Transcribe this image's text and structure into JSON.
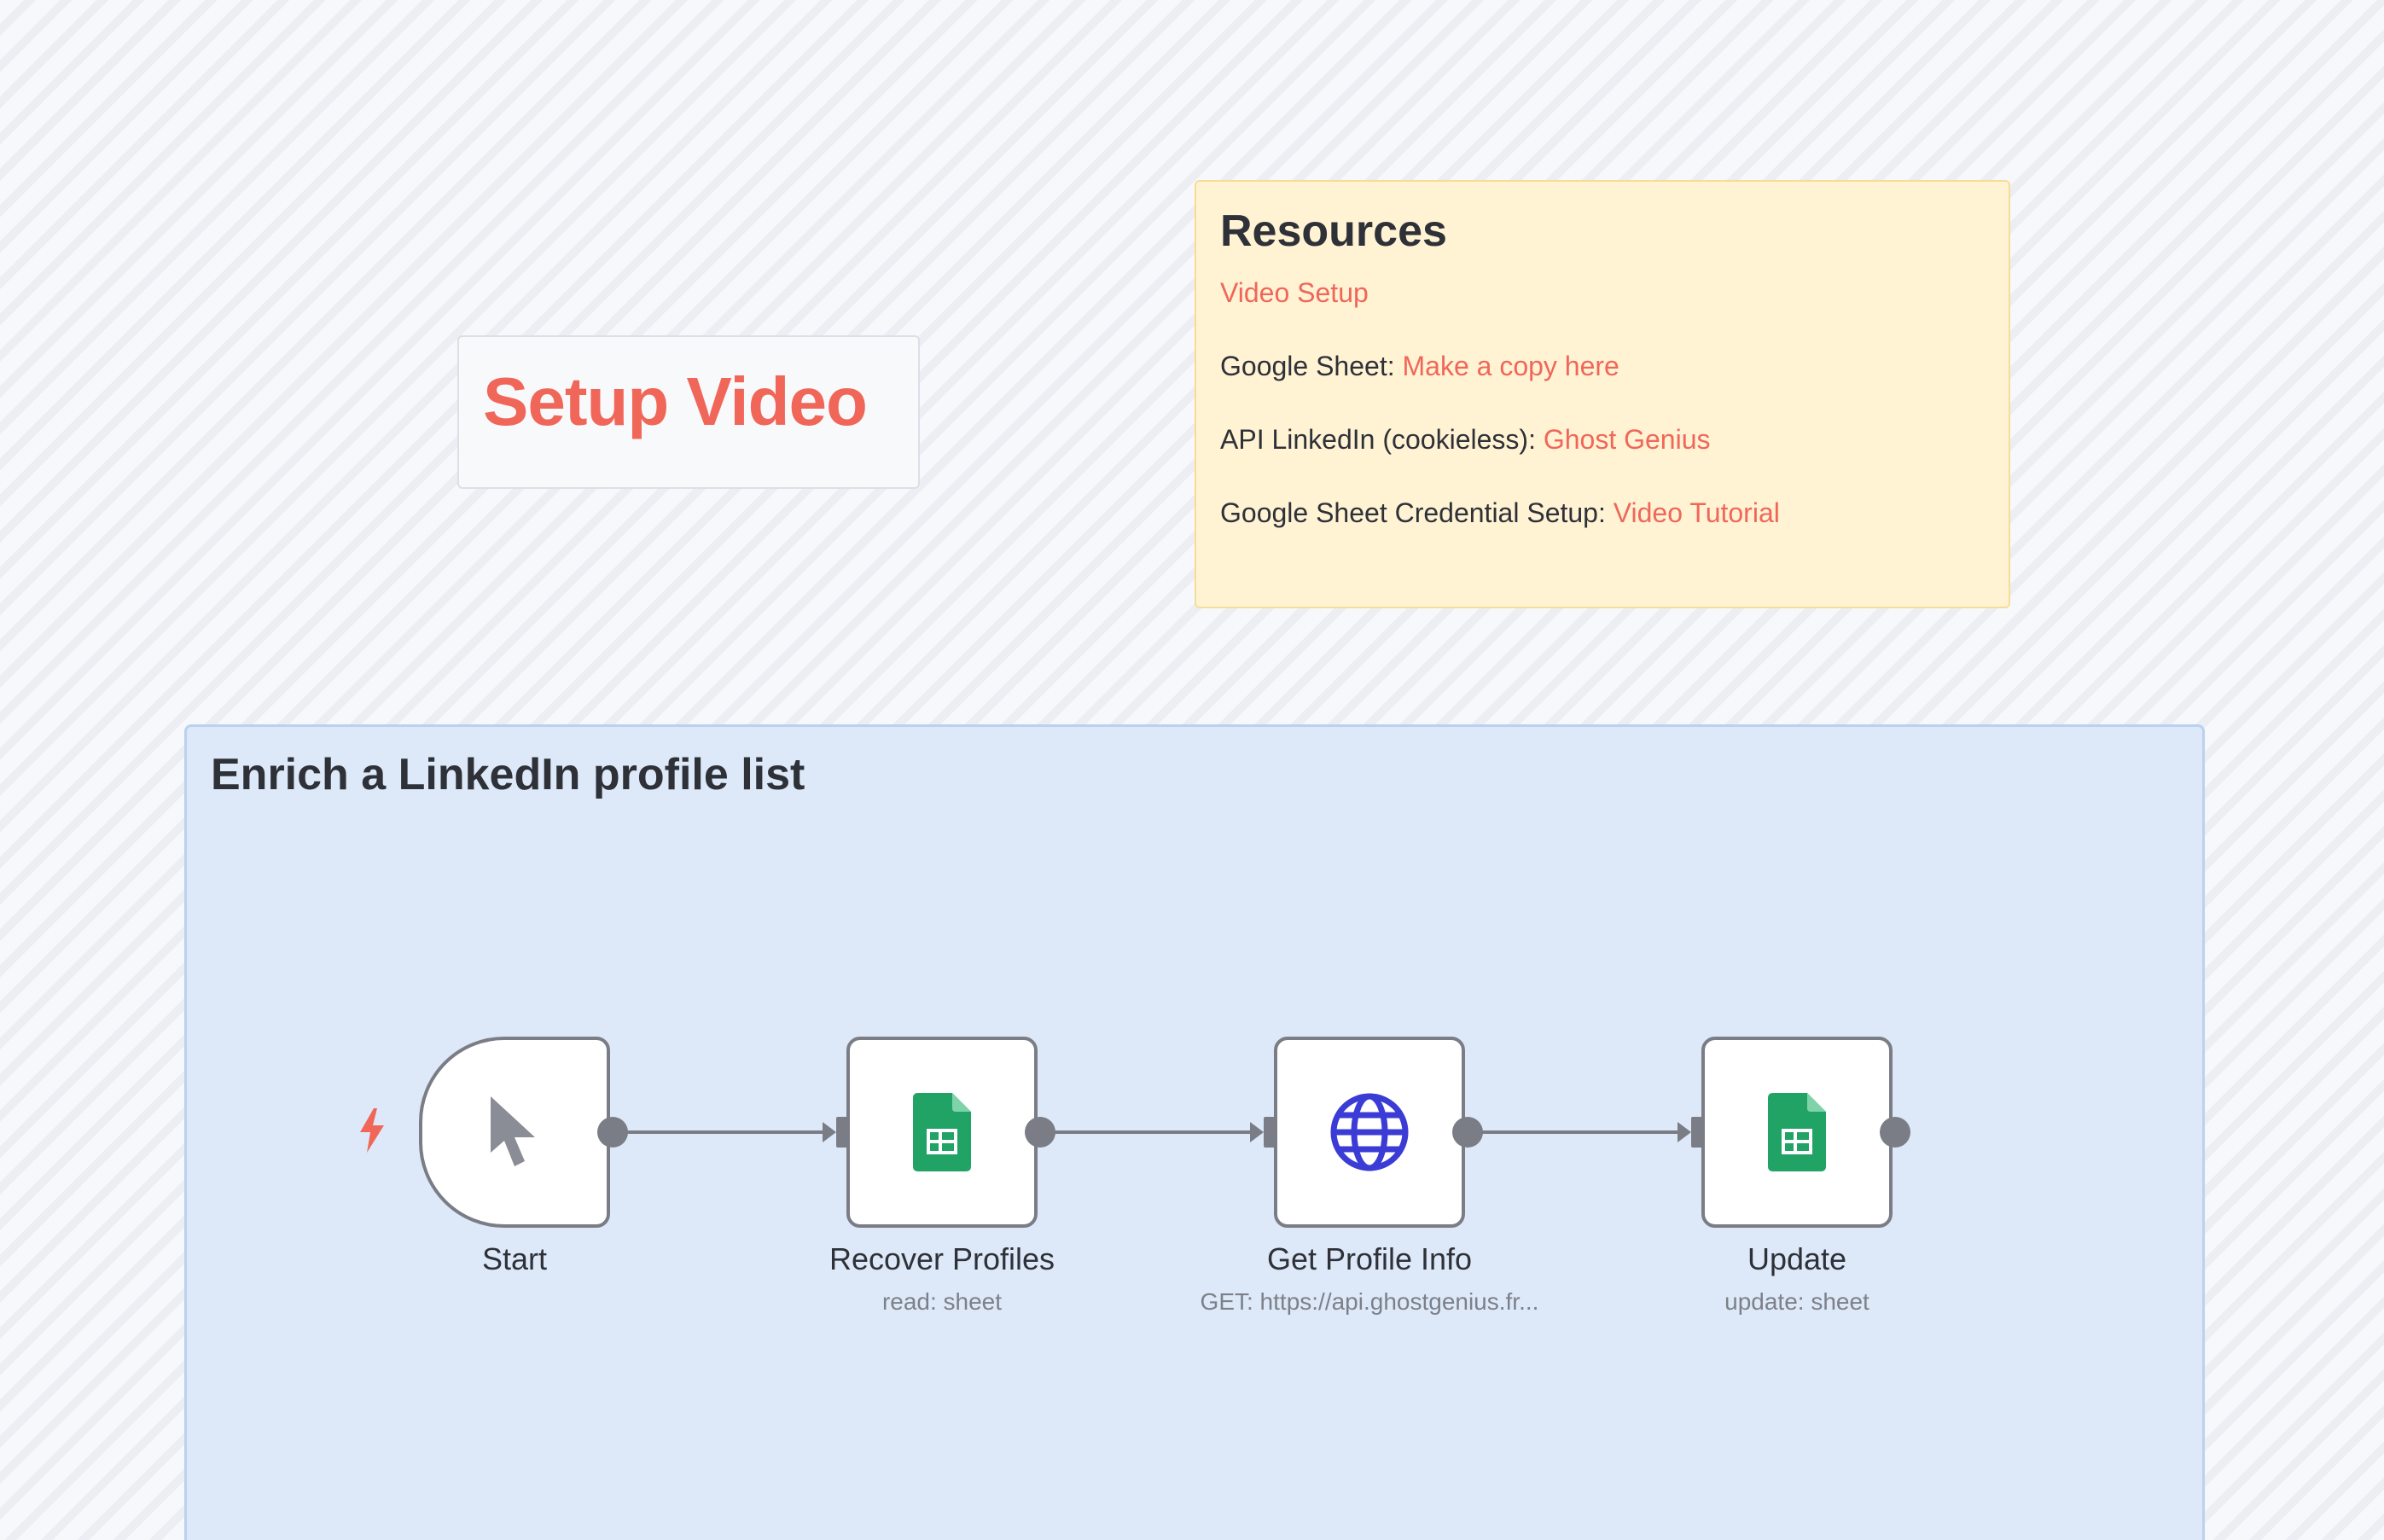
{
  "setup_sticky": {
    "title": "Setup Video"
  },
  "resources_sticky": {
    "title": "Resources",
    "video_setup_link": "Video Setup",
    "sheet_label": "Google Sheet: ",
    "sheet_link": "Make a copy here",
    "api_label": "API LinkedIn (cookieless): ",
    "api_link": "Ghost Genius",
    "credential_label": "Google Sheet Credential Setup: ",
    "credential_link": "Video Tutorial"
  },
  "group_sticky": {
    "title": "Enrich a LinkedIn profile list"
  },
  "nodes": [
    {
      "label": "Start",
      "subtitle": "",
      "icon": "cursor-icon"
    },
    {
      "label": "Recover Profiles",
      "subtitle": "read: sheet",
      "icon": "google-sheets-icon"
    },
    {
      "label": "Get Profile Info",
      "subtitle": "GET: https://api.ghostgenius.fr...",
      "icon": "globe-icon"
    },
    {
      "label": "Update",
      "subtitle": "update: sheet",
      "icon": "google-sheets-icon"
    }
  ],
  "colors": {
    "accent": "#f0675a",
    "node_border": "#7a7d85",
    "sheets_green": "#21a366",
    "globe_blue": "#3b3bd6",
    "resources_bg": "#fff3d4",
    "group_bg": "#dde9f8"
  }
}
